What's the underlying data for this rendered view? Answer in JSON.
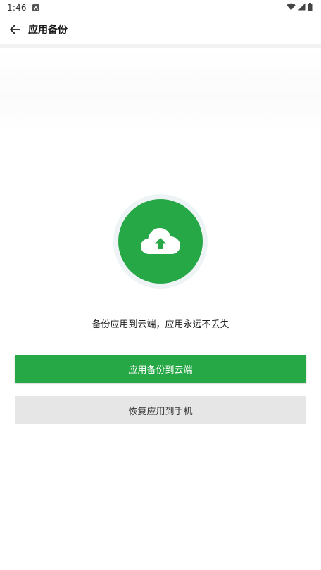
{
  "status_bar": {
    "time": "1:46",
    "notification_icon": "android-auto-icon",
    "icons": [
      "wifi-icon",
      "signal-icon",
      "battery-icon"
    ]
  },
  "app_bar": {
    "back_icon": "arrow-left-icon",
    "title": "应用备份"
  },
  "main": {
    "hero_icon": "cloud-upload-icon",
    "tagline": "备份应用到云端，应用永远不丢失",
    "backup_button_label": "应用备份到云端",
    "restore_button_label": "恢复应用到手机"
  },
  "colors": {
    "accent": "#27a846",
    "secondary_button": "#e6e6e6",
    "badge_ring": "#eef4f6"
  }
}
